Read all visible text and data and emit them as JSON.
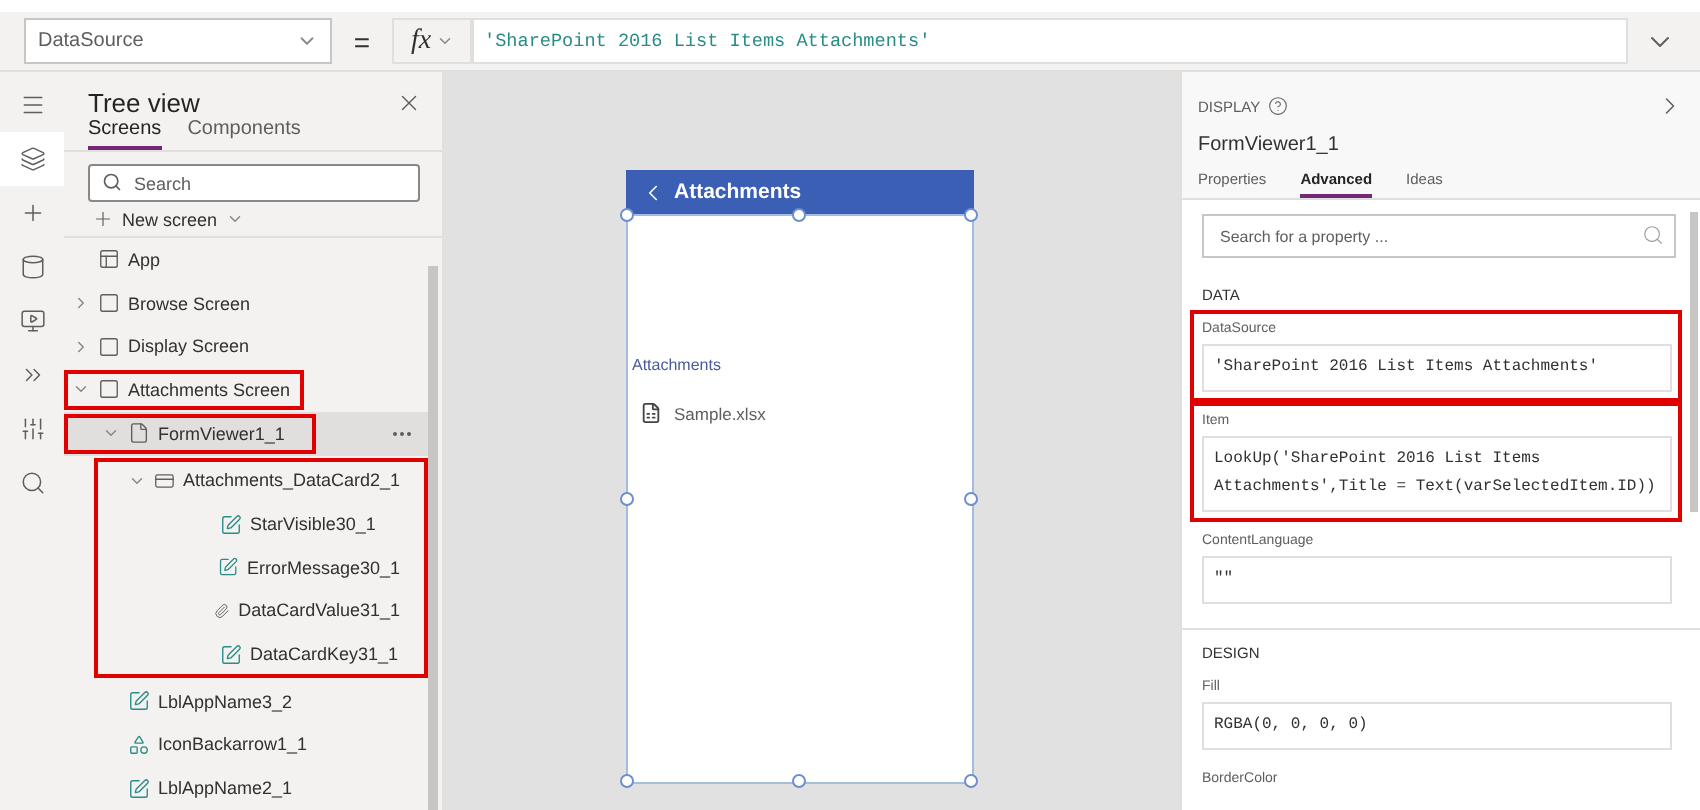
{
  "formula_bar": {
    "property": "DataSource",
    "equals": "=",
    "fx": "fx",
    "formula": "'SharePoint 2016 List Items Attachments'"
  },
  "nav_rail": [
    {
      "selected": false
    },
    {
      "selected": true
    },
    {
      "selected": false
    },
    {
      "selected": false
    },
    {
      "selected": false
    },
    {
      "selected": false
    },
    {
      "selected": false
    },
    {
      "selected": false
    }
  ],
  "tree_view": {
    "title": "Tree view",
    "tabs": [
      {
        "label": "Screens",
        "selected": true
      },
      {
        "label": "Components",
        "selected": false
      }
    ],
    "search": {
      "placeholder": "Search"
    },
    "new_screen": "New screen",
    "items": [
      {
        "label": "App",
        "kind": "app",
        "selected": false,
        "highlighted": false
      },
      {
        "label": "Browse Screen",
        "kind": "screen",
        "expanded": false,
        "selected": false,
        "highlighted": false
      },
      {
        "label": "Display Screen",
        "kind": "screen",
        "expanded": false,
        "selected": false,
        "highlighted": false
      },
      {
        "label": "Attachments Screen",
        "kind": "screen",
        "expanded": true,
        "selected": false,
        "highlighted": true,
        "frame_children": false,
        "children": [
          {
            "label": "FormViewer1_1",
            "kind": "form",
            "expanded": true,
            "selected": true,
            "highlighted": true,
            "frame_children": false,
            "children": [
              {
                "label": "Attachments_DataCard2_1",
                "kind": "card",
                "expanded": true,
                "selected": false,
                "highlighted": true,
                "frame_children": true,
                "children": [
                  {
                    "label": "StarVisible30_1",
                    "kind": "label",
                    "selected": false
                  },
                  {
                    "label": "ErrorMessage30_1",
                    "kind": "label",
                    "selected": false
                  },
                  {
                    "label": "DataCardValue31_1",
                    "kind": "attachment",
                    "selected": false
                  },
                  {
                    "label": "DataCardKey31_1",
                    "kind": "label",
                    "selected": false
                  }
                ]
              }
            ]
          },
          {
            "label": "LblAppName3_2",
            "kind": "label",
            "selected": false,
            "highlighted": false
          },
          {
            "label": "IconBackarrow1_1",
            "kind": "icon",
            "selected": false,
            "highlighted": false
          },
          {
            "label": "LblAppName2_1",
            "kind": "label",
            "selected": false,
            "highlighted": false
          }
        ]
      }
    ]
  },
  "canvas": {
    "header": "Attachments",
    "attachments_label": "Attachments",
    "files": [
      "Sample.xlsx"
    ]
  },
  "properties_panel": {
    "section": "DISPLAY",
    "control_name": "FormViewer1_1",
    "tabs": [
      {
        "label": "Properties",
        "selected": false
      },
      {
        "label": "Advanced",
        "selected": true
      },
      {
        "label": "Ideas",
        "selected": false
      }
    ],
    "search": {
      "placeholder": "Search for a property ..."
    },
    "groups": [
      {
        "title": "DATA",
        "properties": [
          {
            "name": "DataSource",
            "value": "'SharePoint 2016 List Items Attachments'",
            "highlighted": true
          },
          {
            "name": "Item",
            "value": "LookUp('SharePoint 2016 List Items Attachments',Title = Text(varSelectedItem.ID))",
            "highlighted": true
          },
          {
            "name": "ContentLanguage",
            "value": "\"\"",
            "highlighted": false
          }
        ]
      },
      {
        "title": "DESIGN",
        "properties": [
          {
            "name": "Fill",
            "value": "RGBA(0, 0, 0, 0)",
            "highlighted": false
          },
          {
            "name": "BorderColor",
            "highlighted": false
          }
        ]
      }
    ]
  }
}
